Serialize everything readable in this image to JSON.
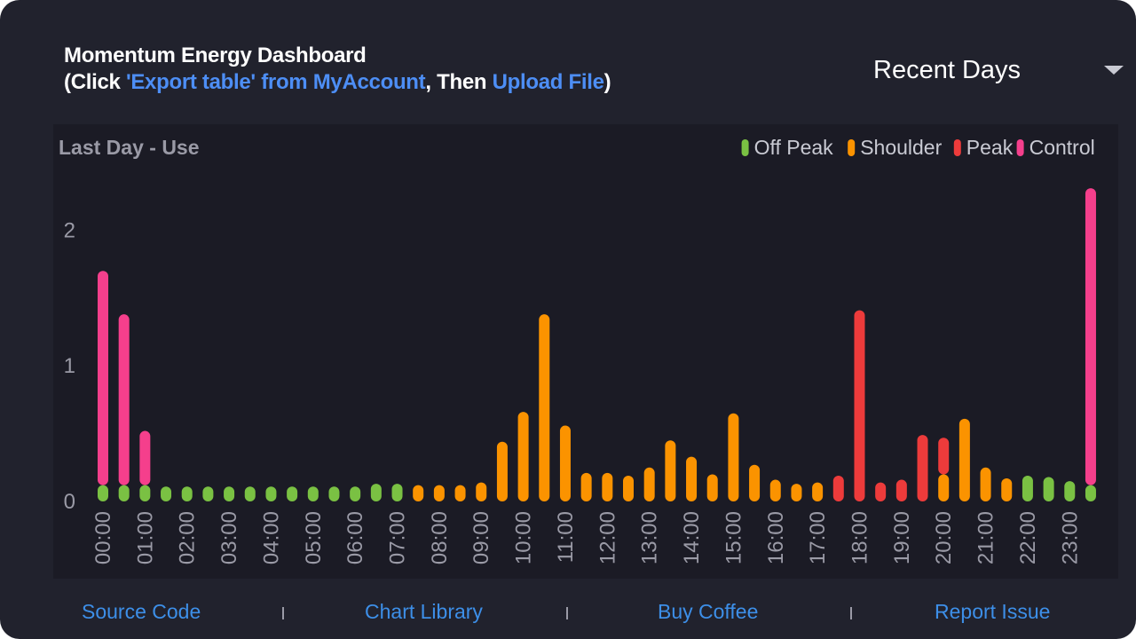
{
  "header": {
    "title": "Momentum Energy Dashboard",
    "instruction_prefix": "(Click ",
    "export_link": "'Export table' from MyAccount",
    "instruction_middle": ", Then ",
    "upload_link": "Upload File",
    "instruction_suffix": ")"
  },
  "range_select": {
    "value": "Recent Days",
    "icon": "chevron-down-icon"
  },
  "footer": {
    "links": [
      "Source Code",
      "Chart Library",
      "Buy Coffee",
      "Report Issue"
    ],
    "separator": "|"
  },
  "colors": {
    "background": "#21222d",
    "panel": "#1b1b25",
    "off_peak": "#7ac143",
    "shoulder": "#fb9300",
    "peak": "#ed3b3b",
    "control": "#f53f8c",
    "link": "#3d8fe8"
  },
  "chart_data": {
    "type": "bar",
    "title": "Last Day - Use",
    "stacked": true,
    "legend_position": "top-right",
    "grid": false,
    "ylim": [
      0,
      2.35
    ],
    "yticks": [
      0,
      1,
      2
    ],
    "xtick_rotation": -90,
    "categories": [
      "00:00",
      "00:30",
      "01:00",
      "01:30",
      "02:00",
      "02:30",
      "03:00",
      "03:30",
      "04:00",
      "04:30",
      "05:00",
      "05:30",
      "06:00",
      "06:30",
      "07:00",
      "07:30",
      "08:00",
      "08:30",
      "09:00",
      "09:30",
      "10:00",
      "10:30",
      "11:00",
      "11:30",
      "12:00",
      "12:30",
      "13:00",
      "13:30",
      "14:00",
      "14:30",
      "15:00",
      "15:30",
      "16:00",
      "16:30",
      "17:00",
      "17:30",
      "18:00",
      "18:30",
      "19:00",
      "19:30",
      "20:00",
      "20:30",
      "21:00",
      "21:30",
      "22:00",
      "22:30",
      "23:00",
      "23:30"
    ],
    "xtick_labels": [
      "00:00",
      "01:00",
      "02:00",
      "03:00",
      "04:00",
      "05:00",
      "06:00",
      "07:00",
      "08:00",
      "09:00",
      "10:00",
      "11:00",
      "12:00",
      "13:00",
      "14:00",
      "15:00",
      "16:00",
      "17:00",
      "18:00",
      "19:00",
      "20:00",
      "21:00",
      "22:00",
      "23:00"
    ],
    "series": [
      {
        "name": "Off Peak",
        "color": "#7ac143",
        "values": [
          0.12,
          0.12,
          0.12,
          0.11,
          0.11,
          0.11,
          0.11,
          0.11,
          0.11,
          0.11,
          0.11,
          0.11,
          0.11,
          0.13,
          0.13,
          0,
          0,
          0,
          0,
          0,
          0,
          0,
          0,
          0,
          0,
          0,
          0,
          0,
          0,
          0,
          0,
          0,
          0,
          0,
          0,
          0,
          0,
          0,
          0,
          0,
          0,
          0,
          0,
          0,
          0.19,
          0.18,
          0.15,
          0.12
        ]
      },
      {
        "name": "Shoulder",
        "color": "#fb9300",
        "values": [
          0,
          0,
          0,
          0,
          0,
          0,
          0,
          0,
          0,
          0,
          0,
          0,
          0,
          0,
          0,
          0.12,
          0.12,
          0.12,
          0.14,
          0.44,
          0.66,
          1.38,
          0.56,
          0.21,
          0.21,
          0.19,
          0.25,
          0.45,
          0.33,
          0.2,
          0.65,
          0.27,
          0.16,
          0.13,
          0.14,
          0,
          0,
          0,
          0,
          0,
          0.2,
          0.61,
          0.25,
          0.17,
          0,
          0,
          0,
          0
        ]
      },
      {
        "name": "Peak",
        "color": "#ed3b3b",
        "values": [
          0,
          0,
          0,
          0,
          0,
          0,
          0,
          0,
          0,
          0,
          0,
          0,
          0,
          0,
          0,
          0,
          0,
          0,
          0,
          0,
          0,
          0,
          0,
          0,
          0,
          0,
          0,
          0,
          0,
          0,
          0,
          0,
          0,
          0,
          0,
          0.19,
          1.41,
          0.14,
          0.16,
          0.49,
          0.27,
          0,
          0,
          0,
          0,
          0,
          0,
          0
        ]
      },
      {
        "name": "Control",
        "color": "#f53f8c",
        "values": [
          1.58,
          1.26,
          0.4,
          0,
          0,
          0,
          0,
          0,
          0,
          0,
          0,
          0,
          0,
          0,
          0,
          0,
          0,
          0,
          0,
          0,
          0,
          0,
          0,
          0,
          0,
          0,
          0,
          0,
          0,
          0,
          0,
          0,
          0,
          0,
          0,
          0,
          0,
          0,
          0,
          0,
          0,
          0,
          0,
          0,
          0,
          0,
          0,
          2.19
        ]
      }
    ]
  }
}
